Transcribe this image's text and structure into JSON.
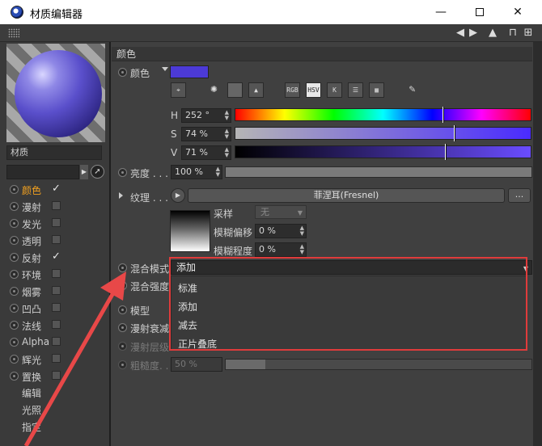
{
  "window": {
    "title": "材质编辑器",
    "minimize": "—",
    "maximize": "",
    "close": "✕"
  },
  "toolbar": {
    "nav_left": "◀",
    "nav_right": "▶",
    "mountain": "⛰",
    "lock": "🔒",
    "add": "⊞"
  },
  "material": {
    "name_label": "材质"
  },
  "channels": [
    {
      "label": "颜色",
      "checked": true,
      "active": true
    },
    {
      "label": "漫射",
      "checked": false
    },
    {
      "label": "发光",
      "checked": false
    },
    {
      "label": "透明",
      "checked": false
    },
    {
      "label": "反射",
      "checked": true
    },
    {
      "label": "环境",
      "checked": false
    },
    {
      "label": "烟雾",
      "checked": false
    },
    {
      "label": "凹凸",
      "checked": false
    },
    {
      "label": "法线",
      "checked": false
    },
    {
      "label": "Alpha",
      "checked": false
    },
    {
      "label": "辉光",
      "checked": false
    },
    {
      "label": "置换",
      "checked": false
    }
  ],
  "subitems": [
    "编辑",
    "光照",
    "指定"
  ],
  "section": {
    "title": "颜色"
  },
  "color": {
    "label": "颜色",
    "swatch": "#4c3ad6",
    "modes": [
      "⌖",
      "✺",
      "■",
      "▲",
      "RGB",
      "HSV",
      "K",
      "☰",
      "▦",
      "✎"
    ],
    "h_label": "H",
    "h_value": "252 °",
    "h_fraction": 0.7,
    "s_label": "S",
    "s_value": "74 %",
    "s_fraction": 0.74,
    "v_label": "V",
    "v_value": "71 %",
    "v_fraction": 0.71
  },
  "brightness": {
    "label": "亮度 . . .",
    "value": "100 %",
    "fraction": 1.0
  },
  "texture": {
    "label": "纹理 . . .",
    "shader": "菲涅耳(Fresnel)",
    "more": "...",
    "sampling_label": "采样",
    "sampling_value": "无",
    "blur_offset_label": "模糊偏移",
    "blur_offset_value": "0 %",
    "blur_scale_label": "模糊程度",
    "blur_scale_value": "0 %"
  },
  "blend": {
    "mode_label": "混合模式",
    "mode_value": "添加",
    "strength_label": "混合强度",
    "options": [
      "标准",
      "添加",
      "减去",
      "正片叠底"
    ]
  },
  "model": {
    "label": "模型",
    "diffuse_falloff_label": "漫射衰减",
    "diffuse_level_label": "漫射层级",
    "roughness_label": "粗糙度. . .",
    "roughness_value": "50 %",
    "roughness_fraction": 0.5
  },
  "colors": {
    "accent": "#f0a020",
    "highlight_border": "#e03b3b"
  }
}
